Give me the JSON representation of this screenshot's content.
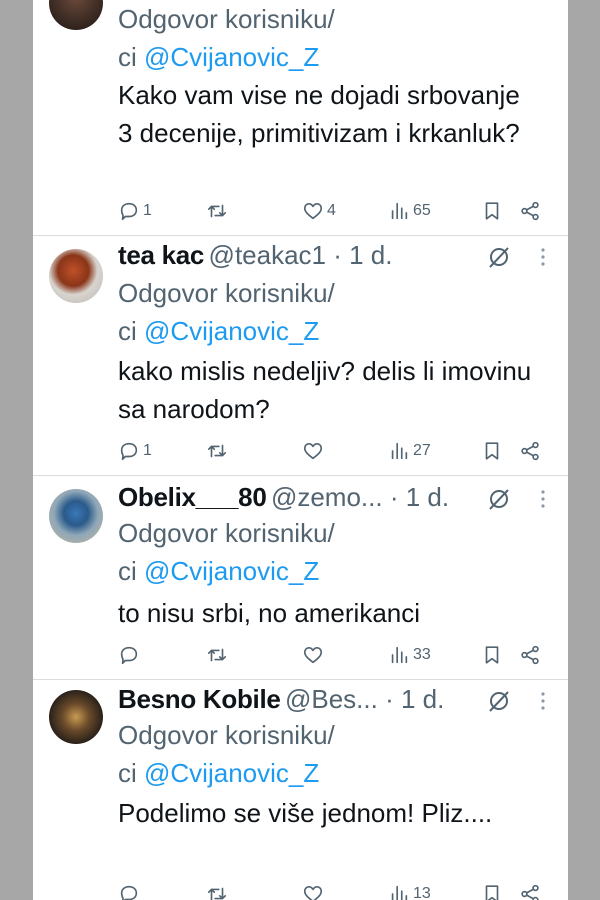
{
  "tweets": [
    {
      "author": "",
      "handle": "",
      "time": "",
      "reply_prefix": "Odgovor korisniku/",
      "reply_to_prefix": "ci",
      "reply_to": "@Cvijanovic_Z",
      "text": "Kako vam vise ne dojadi srbovanje 3 decenije, primitivizam i krkanluk?",
      "replies": "1",
      "retweets": "",
      "likes": "4",
      "views": "65"
    },
    {
      "author": "tea kac",
      "handle": "@teakac1",
      "time": "1 d.",
      "reply_prefix": "Odgovor korisniku/",
      "reply_to_prefix": "ci",
      "reply_to": "@Cvijanovic_Z",
      "text": "kako mislis nedeljiv? delis li imovinu sa narodom?",
      "replies": "1",
      "retweets": "",
      "likes": "",
      "views": "27"
    },
    {
      "author": "Obelix___80",
      "handle": "@zemo...",
      "time": "1 d.",
      "reply_prefix": "Odgovor korisniku/",
      "reply_to_prefix": "ci",
      "reply_to": "@Cvijanovic_Z",
      "text": "to nisu srbi, no amerikanci",
      "replies": "",
      "retweets": "",
      "likes": "",
      "views": "33"
    },
    {
      "author": "Besno Kobile",
      "handle": "@Bes...",
      "time": "1 d.",
      "reply_prefix": "Odgovor korisniku/",
      "reply_to_prefix": "ci",
      "reply_to": "@Cvijanovic_Z",
      "text": "Podelimo se više jednom! Pliz....",
      "replies": "",
      "retweets": "",
      "likes": "",
      "views": "13"
    }
  ],
  "icons": {
    "reply": "reply-icon",
    "retweet": "retweet-icon",
    "like": "heart-icon",
    "views": "views-icon",
    "bookmark": "bookmark-icon",
    "share": "share-icon",
    "grok": "grok-icon",
    "more": "more-icon"
  },
  "colors": {
    "text": "#0f1419",
    "secondary": "#536471",
    "mention": "#1d9bf0",
    "divider": "#dcdcdc",
    "backdrop": "#a7a7a7"
  }
}
